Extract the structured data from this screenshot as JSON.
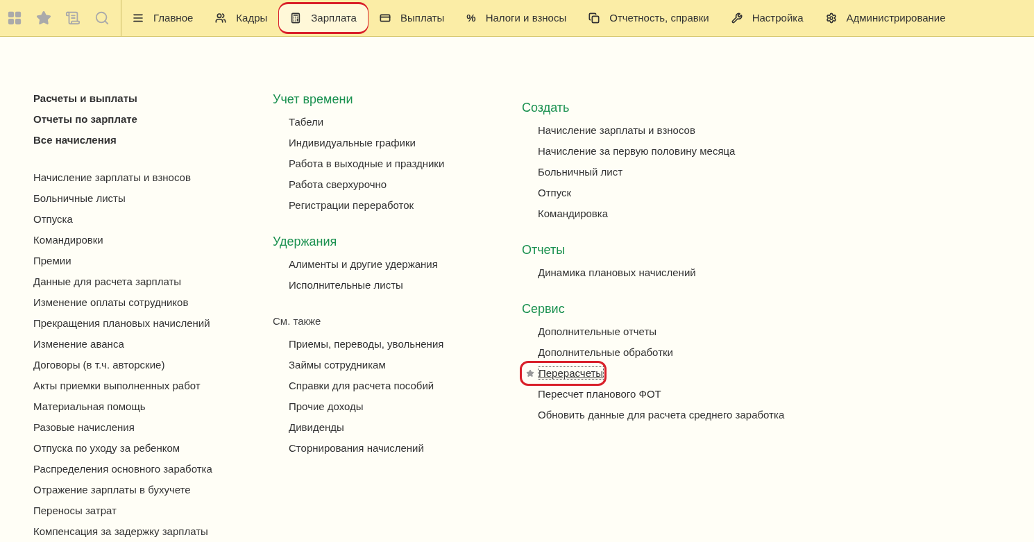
{
  "toolbar": {
    "tools": [
      {
        "kind": "grid"
      },
      {
        "kind": "star"
      },
      {
        "kind": "history"
      },
      {
        "kind": "search"
      }
    ]
  },
  "tabs": [
    {
      "label": "Главное",
      "kind": "menu",
      "selected": false,
      "annotated": false
    },
    {
      "label": "Кадры",
      "kind": "users",
      "selected": false,
      "annotated": false
    },
    {
      "label": "Зарплата",
      "kind": "calculator",
      "selected": true,
      "annotated": true
    },
    {
      "label": "Выплаты",
      "kind": "wallet",
      "selected": false,
      "annotated": false
    },
    {
      "label": "Налоги и взносы",
      "kind": "char",
      "icon_text": "%",
      "selected": false,
      "annotated": false
    },
    {
      "label": "Отчетность, справки",
      "kind": "copy",
      "selected": false,
      "annotated": false
    },
    {
      "label": "Настройка",
      "kind": "wrench",
      "selected": false,
      "annotated": false
    },
    {
      "label": "Администрирование",
      "kind": "gear",
      "selected": false,
      "annotated": false
    }
  ],
  "columns": [
    {
      "sections": [
        {
          "kind": "bold",
          "items": [
            {
              "label": "Расчеты и выплаты"
            },
            {
              "label": "Отчеты по зарплате"
            },
            {
              "label": "Все начисления"
            }
          ]
        },
        {
          "kind": "plain",
          "items": [
            {
              "label": "Начисление зарплаты и взносов"
            },
            {
              "label": "Больничные листы"
            },
            {
              "label": "Отпуска"
            },
            {
              "label": "Командировки"
            },
            {
              "label": "Премии"
            },
            {
              "label": "Данные для расчета зарплаты"
            },
            {
              "label": "Изменение оплаты сотрудников"
            },
            {
              "label": "Прекращения плановых начислений"
            },
            {
              "label": "Изменение аванса"
            },
            {
              "label": "Договоры (в т.ч. авторские)"
            },
            {
              "label": "Акты приемки выполненных работ"
            },
            {
              "label": "Материальная помощь"
            },
            {
              "label": "Разовые начисления"
            },
            {
              "label": "Отпуска по уходу за ребенком"
            },
            {
              "label": "Распределения основного заработка"
            },
            {
              "label": "Отражение зарплаты в бухучете"
            },
            {
              "label": "Переносы затрат"
            },
            {
              "label": "Компенсация за задержку зарплаты"
            }
          ]
        }
      ]
    },
    {
      "sections": [
        {
          "kind": "group",
          "title": "Учет времени",
          "items": [
            {
              "label": "Табели"
            },
            {
              "label": "Индивидуальные графики"
            },
            {
              "label": "Работа в выходные и праздники"
            },
            {
              "label": "Работа сверхурочно"
            },
            {
              "label": "Регистрации переработок"
            }
          ]
        },
        {
          "kind": "group",
          "title": "Удержания",
          "items": [
            {
              "label": "Алименты и другие удержания"
            },
            {
              "label": "Исполнительные листы"
            }
          ]
        },
        {
          "kind": "see_also",
          "title": "См. также",
          "items": [
            {
              "label": "Приемы, переводы, увольнения"
            },
            {
              "label": "Займы сотрудникам"
            },
            {
              "label": "Справки для расчета пособий"
            },
            {
              "label": "Прочие доходы"
            },
            {
              "label": "Дивиденды"
            },
            {
              "label": "Сторнирования начислений"
            }
          ]
        }
      ]
    },
    {
      "sections": [
        {
          "kind": "group",
          "title": "Создать",
          "items": [
            {
              "label": "Начисление зарплаты и взносов"
            },
            {
              "label": "Начисление за первую половину месяца"
            },
            {
              "label": "Больничный лист"
            },
            {
              "label": "Отпуск"
            },
            {
              "label": "Командировка"
            }
          ]
        },
        {
          "kind": "group",
          "title": "Отчеты",
          "items": [
            {
              "label": "Динамика плановых начислений"
            }
          ]
        },
        {
          "kind": "group",
          "title": "Сервис",
          "items": [
            {
              "label": "Дополнительные отчеты",
              "favorite": false,
              "focused": false,
              "annotated": false
            },
            {
              "label": "Дополнительные обработки",
              "favorite": false,
              "focused": false,
              "annotated": false
            },
            {
              "label": "Перерасчеты",
              "favorite": true,
              "focused": true,
              "annotated": true
            },
            {
              "label": "Пересчет планового ФОТ",
              "favorite": false,
              "focused": false,
              "annotated": false
            },
            {
              "label": "Обновить данные для расчета среднего заработка",
              "favorite": false,
              "focused": false,
              "annotated": false
            }
          ]
        }
      ]
    }
  ]
}
